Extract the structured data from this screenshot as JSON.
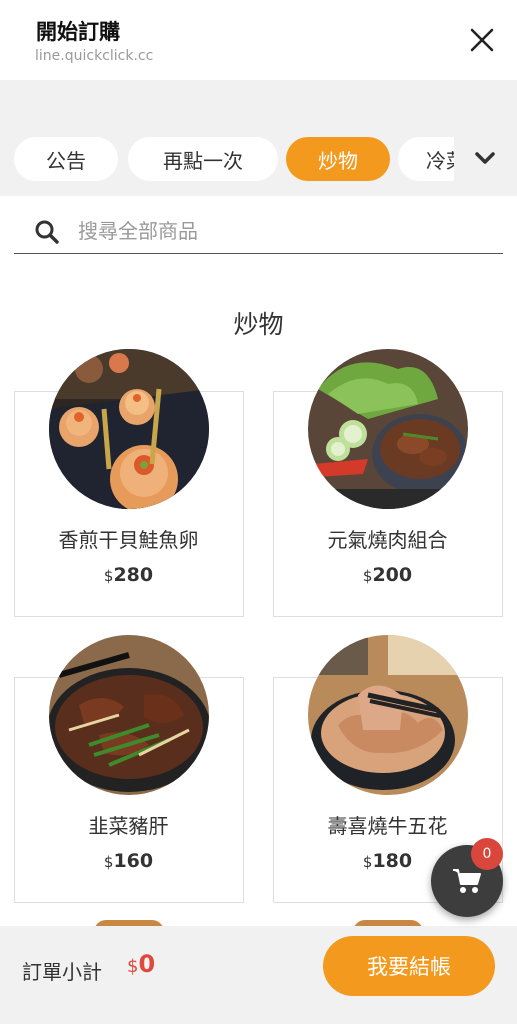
{
  "header": {
    "title": "開始訂購",
    "url": "line.quickclick.cc",
    "close_icon": "close-icon"
  },
  "tabs": [
    {
      "label": "公告",
      "active": false
    },
    {
      "label": "再點一次",
      "active": false
    },
    {
      "label": "炒物",
      "active": true
    },
    {
      "label": "冷菜",
      "active": false
    }
  ],
  "tabs_more_icon": "chevron-down-icon",
  "search": {
    "placeholder": "搜尋全部商品",
    "value": ""
  },
  "section": {
    "title": "炒物"
  },
  "items": [
    {
      "name": "香煎干貝鮭魚卵",
      "currency": "$",
      "price": "280",
      "image": "scallop-salmon-roe-photo"
    },
    {
      "name": "元氣燒肉組合",
      "currency": "$",
      "price": "200",
      "image": "yakiniku-set-photo"
    },
    {
      "name": "韭菜豬肝",
      "currency": "$",
      "price": "160",
      "image": "pork-liver-chives-photo"
    },
    {
      "name": "壽喜燒牛五花",
      "currency": "$",
      "price": "180",
      "image": "sukiyaki-beef-photo"
    }
  ],
  "cart": {
    "count": "0",
    "icon": "cart-icon"
  },
  "footer": {
    "subtotal_label": "訂單小計",
    "subtotal_currency": "$",
    "subtotal_value": "0",
    "checkout_label": "我要結帳"
  },
  "colors": {
    "accent": "#f39a1e",
    "badge": "#d9463b",
    "fab": "#3d3d3d",
    "background_band": "#f1f1f1"
  }
}
